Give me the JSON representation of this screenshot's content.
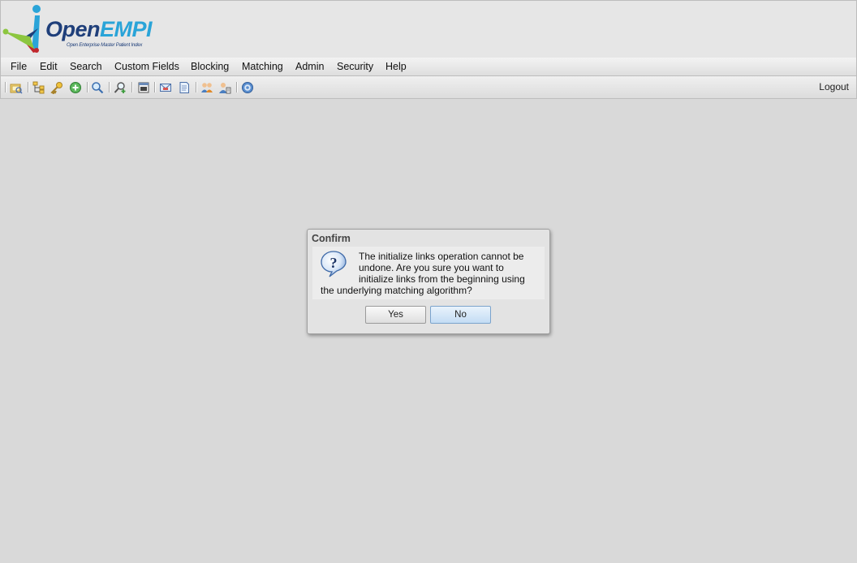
{
  "app": {
    "logo_part1": "Open",
    "logo_part2": "EMPI",
    "logo_tagline": "Open Enterprise Master Patient Index"
  },
  "menu": {
    "items": [
      "File",
      "Edit",
      "Search",
      "Custom Fields",
      "Blocking",
      "Matching",
      "Admin",
      "Security",
      "Help"
    ]
  },
  "toolbar": {
    "icons": [
      "open-folder-icon",
      "tree-structure-icon",
      "key-icon",
      "add-circle-icon",
      "search-icon",
      "advanced-search-icon",
      "calendar-icon",
      "email-icon",
      "document-icon",
      "users-icon",
      "user-identity-icon",
      "help-icon"
    ],
    "logout_label": "Logout"
  },
  "dialog": {
    "title": "Confirm",
    "icon": "question-icon",
    "message": "The initialize links operation cannot be undone. Are you sure you want to initialize links from the beginning using the underlying matching algorithm?",
    "yes_label": "Yes",
    "no_label": "No"
  },
  "colors": {
    "background": "#d9d9d9",
    "logo_dark_blue": "#1f3f7a",
    "logo_light_blue": "#2aa4d8",
    "primary_button": "#c3dcf4"
  }
}
